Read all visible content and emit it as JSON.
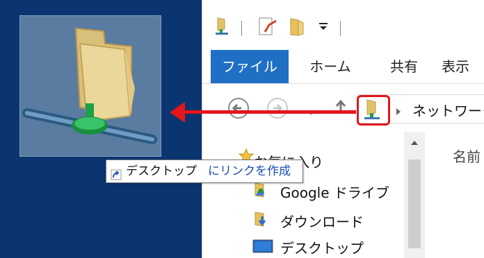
{
  "tooltip": {
    "icon": "shortcut-arrow-icon",
    "prefix": "デスクトップ",
    "action": "にリンクを作成"
  },
  "ribbon": {
    "tabs": [
      {
        "label": "ファイル",
        "active": true
      },
      {
        "label": "ホーム"
      },
      {
        "label": "共有"
      },
      {
        "label": "表示"
      }
    ]
  },
  "address": {
    "path": "ネットワーク"
  },
  "column": {
    "name_header": "名前"
  },
  "nav": {
    "items": [
      {
        "label": "お気に入り",
        "icon": "star-icon"
      },
      {
        "label": "Google ドライブ",
        "icon": "google-drive-folder-icon"
      },
      {
        "label": "ダウンロード",
        "icon": "downloads-folder-icon"
      },
      {
        "label": "デスクトップ",
        "icon": "desktop-icon"
      }
    ]
  },
  "colors": {
    "desktop_bg": "#0a3570",
    "accent_tab": "#1f6fc5",
    "annotation_red": "#e4151c"
  }
}
